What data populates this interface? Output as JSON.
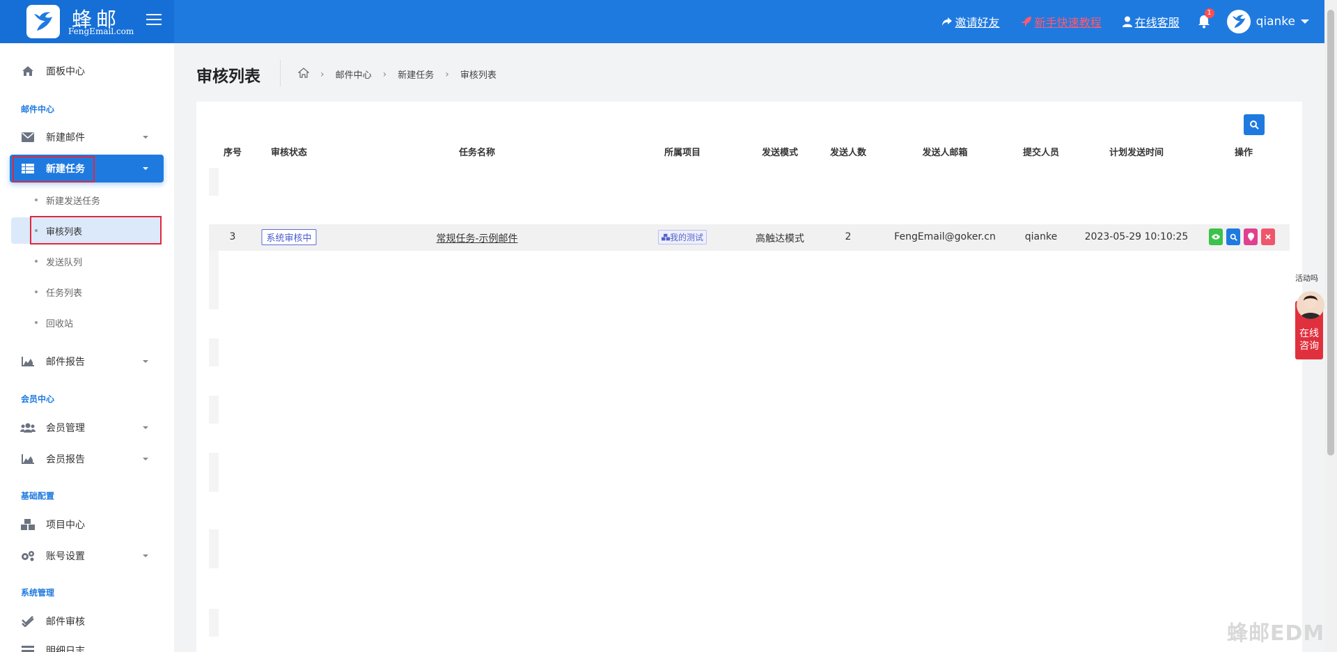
{
  "brand": {
    "name_cn": "蜂邮",
    "name_en": "FengEmail.com"
  },
  "topbar": {
    "invite": "邀请好友",
    "tutorial": "新手快速教程",
    "support": "在线客服",
    "notifications": "1",
    "username": "qianke"
  },
  "sidebar": {
    "dashboard": "面板中心",
    "section_mail": "邮件中心",
    "new_mail": "新建邮件",
    "new_task": "新建任务",
    "sub": {
      "new_send_task": "新建发送任务",
      "review_list": "审核列表",
      "send_queue": "发送队列",
      "task_list": "任务列表",
      "recycle": "回收站"
    },
    "mail_report": "邮件报告",
    "section_member": "会员中心",
    "member_manage": "会员管理",
    "member_report": "会员报告",
    "section_config": "基础配置",
    "project_center": "项目中心",
    "account_settings": "账号设置",
    "section_system": "系统管理",
    "mail_review": "邮件审核",
    "detail_log": "明细日志"
  },
  "page": {
    "title": "审核列表",
    "breadcrumb": [
      "邮件中心",
      "新建任务",
      "审核列表"
    ]
  },
  "table": {
    "headers": {
      "index": "序号",
      "status": "审核状态",
      "name": "任务名称",
      "project": "所属项目",
      "mode": "发送模式",
      "count": "发送人数",
      "sender": "发送人邮箱",
      "submitter": "提交人员",
      "time": "计划发送时间",
      "ops": "操作"
    },
    "rows": [
      {
        "index": "3",
        "status": "系统审核中",
        "name": "常规任务-示例邮件",
        "project": "我的测试",
        "mode": "高触达模式",
        "count": "2",
        "sender": "FengEmail@goker.cn",
        "submitter": "qianke",
        "time": "2023-05-29 10:10:25"
      }
    ]
  },
  "float_widget": {
    "label": "活动吗",
    "text_line1": "在线",
    "text_line2": "咨询"
  },
  "watermark": "蜂邮EDM",
  "colors": {
    "primary": "#1f7ae0",
    "highlight": "#e0283c",
    "view": "#3cc14a",
    "search": "#1f7ae0",
    "pin": "#e0408f",
    "delete": "#f0566b"
  }
}
